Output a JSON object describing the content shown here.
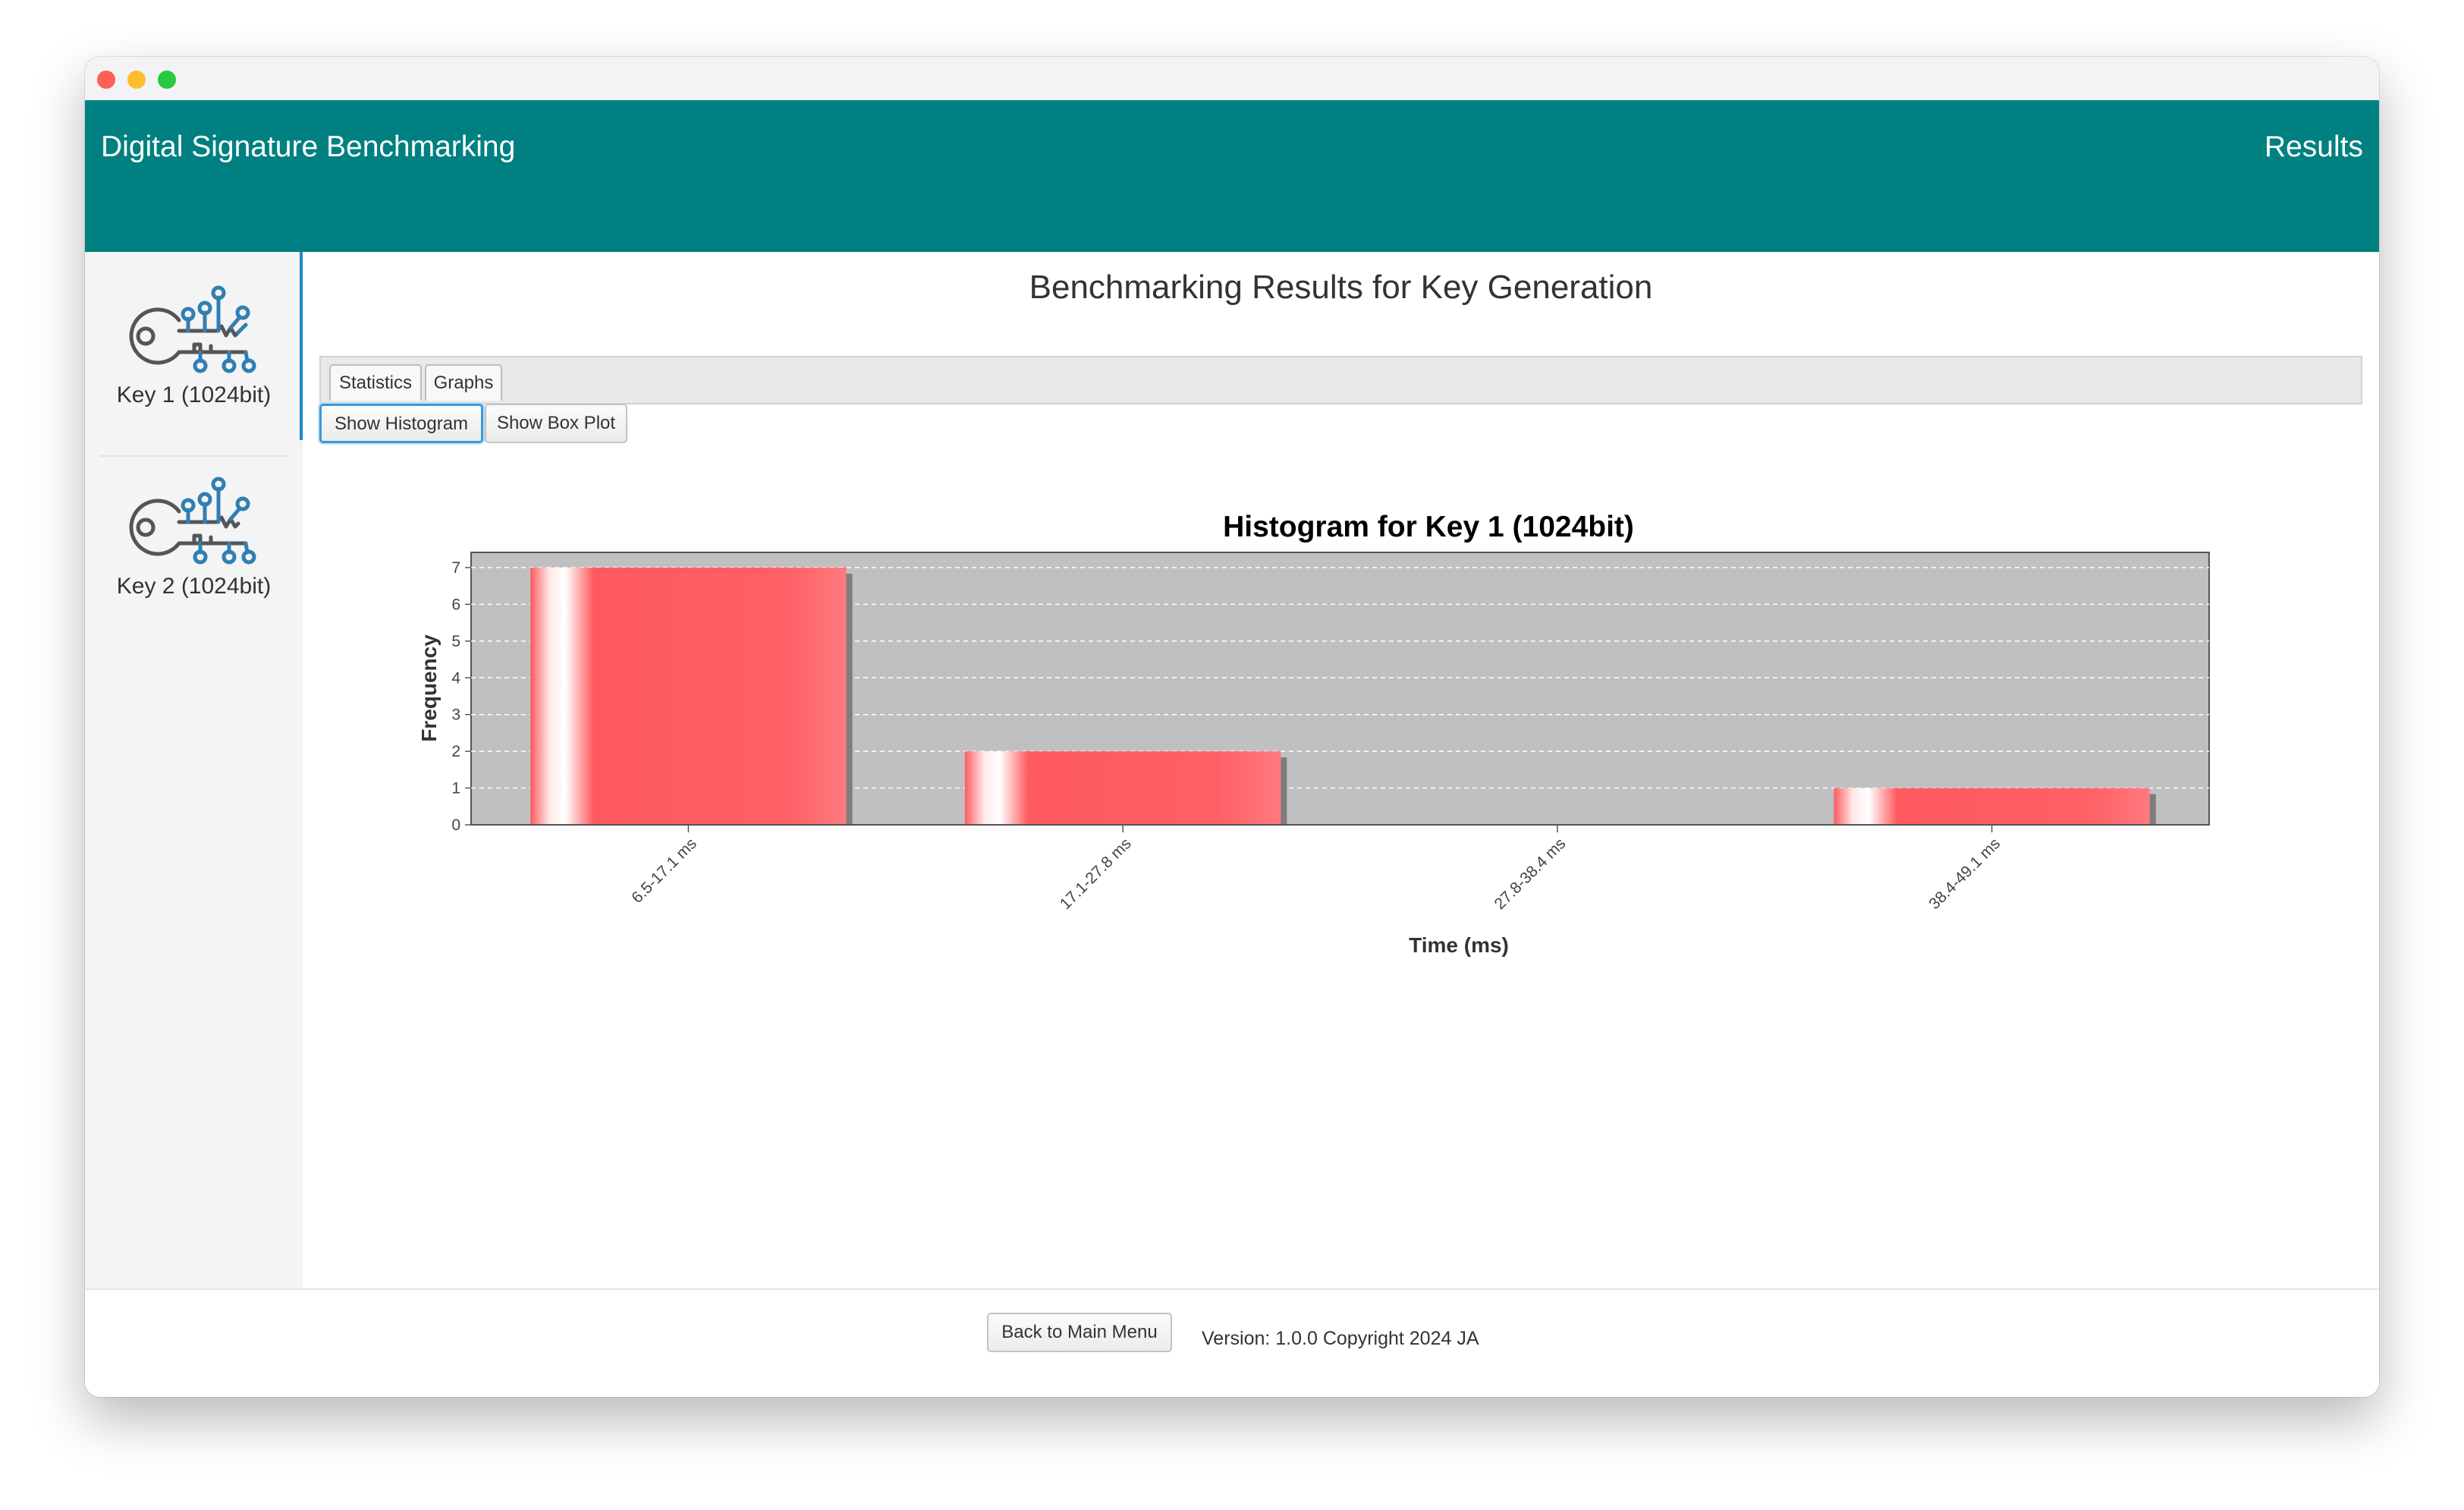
{
  "header": {
    "app_title": "Digital Signature Benchmarking",
    "section": "Results"
  },
  "sidebar": {
    "items": [
      {
        "label": "Key 1 (1024bit)",
        "icon": "digital-key-icon"
      },
      {
        "label": "Key 2 (1024bit)",
        "icon": "digital-key-icon"
      }
    ]
  },
  "main": {
    "title": "Benchmarking Results for Key Generation",
    "tabs": [
      {
        "label": "Statistics"
      },
      {
        "label": "Graphs"
      }
    ],
    "buttons": {
      "histogram": "Show Histogram",
      "boxplot": "Show Box Plot"
    }
  },
  "footer": {
    "back_label": "Back to Main Menu",
    "version": "Version: 1.0.0 Copyright 2024 JA"
  },
  "colors": {
    "header": "#008080",
    "bar": "#ff5a5f",
    "plot_bg": "#c0c0c0",
    "accent": "#1e88c9"
  },
  "chart_data": {
    "type": "bar",
    "title": "Histogram for Key 1 (1024bit)",
    "xlabel": "Time (ms)",
    "ylabel": "Frequency",
    "categories": [
      "6.5-17.1 ms",
      "17.1-27.8 ms",
      "27.8-38.4 ms",
      "38.4-49.1 ms"
    ],
    "values": [
      7,
      2,
      0,
      1
    ],
    "ylim": [
      0,
      7
    ],
    "yticks": [
      0,
      1,
      2,
      3,
      4,
      5,
      6,
      7
    ],
    "grid": true
  }
}
